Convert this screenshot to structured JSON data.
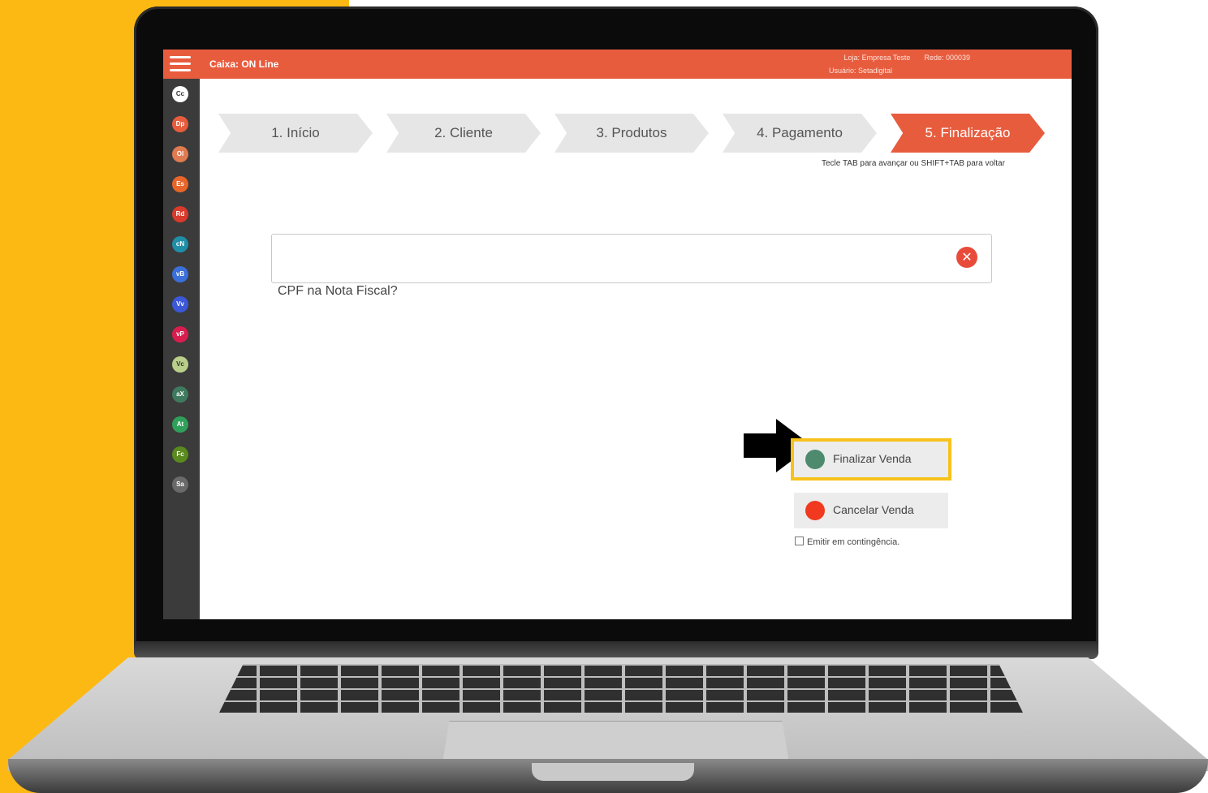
{
  "header": {
    "title": "Caixa: ON Line",
    "loja_label": "Loja:",
    "loja_value": "Empresa Teste",
    "rede_label": "Rede:",
    "rede_value": "000039",
    "usuario_label": "Usuário:",
    "usuario_value": "Setadigital"
  },
  "sidebar": {
    "items": [
      {
        "code": "Cc",
        "color": "#ffffff",
        "text_color": "#333333"
      },
      {
        "code": "Dp",
        "color": "#E85C3E"
      },
      {
        "code": "Ol",
        "color": "#E07A50"
      },
      {
        "code": "Es",
        "color": "#E8652A"
      },
      {
        "code": "Rd",
        "color": "#D93A2B"
      },
      {
        "code": "cN",
        "color": "#1F8FA8"
      },
      {
        "code": "vB",
        "color": "#3B6FD9"
      },
      {
        "code": "Vv",
        "color": "#3B58D9"
      },
      {
        "code": "vP",
        "color": "#D91E4F"
      },
      {
        "code": "Vc",
        "color": "#B9CF8A",
        "text_color": "#333333"
      },
      {
        "code": "aX",
        "color": "#3E7A5E"
      },
      {
        "code": "At",
        "color": "#2FA05A"
      },
      {
        "code": "Fc",
        "color": "#5A8A1E"
      },
      {
        "code": "Sa",
        "color": "#6A6A6A"
      }
    ]
  },
  "steps": [
    {
      "label": "1. Início",
      "active": false
    },
    {
      "label": "2. Cliente",
      "active": false
    },
    {
      "label": "3. Produtos",
      "active": false
    },
    {
      "label": "4. Pagamento",
      "active": false
    },
    {
      "label": "5. Finalização",
      "active": true
    }
  ],
  "tab_hint": "Tecle TAB para avançar ou SHIFT+TAB para voltar",
  "cpf": {
    "value": "",
    "label": "CPF na Nota Fiscal?",
    "clear_icon": "close-icon"
  },
  "actions": {
    "finalizar_label": "Finalizar Venda",
    "finalizar_color": "#4E8A6E",
    "cancelar_label": "Cancelar Venda",
    "cancelar_color": "#F0391E",
    "contingencia_label": "Emitir em contingência."
  },
  "colors": {
    "accent": "#E85C3E",
    "highlight": "#F7C21B",
    "background": "#FDB913"
  }
}
